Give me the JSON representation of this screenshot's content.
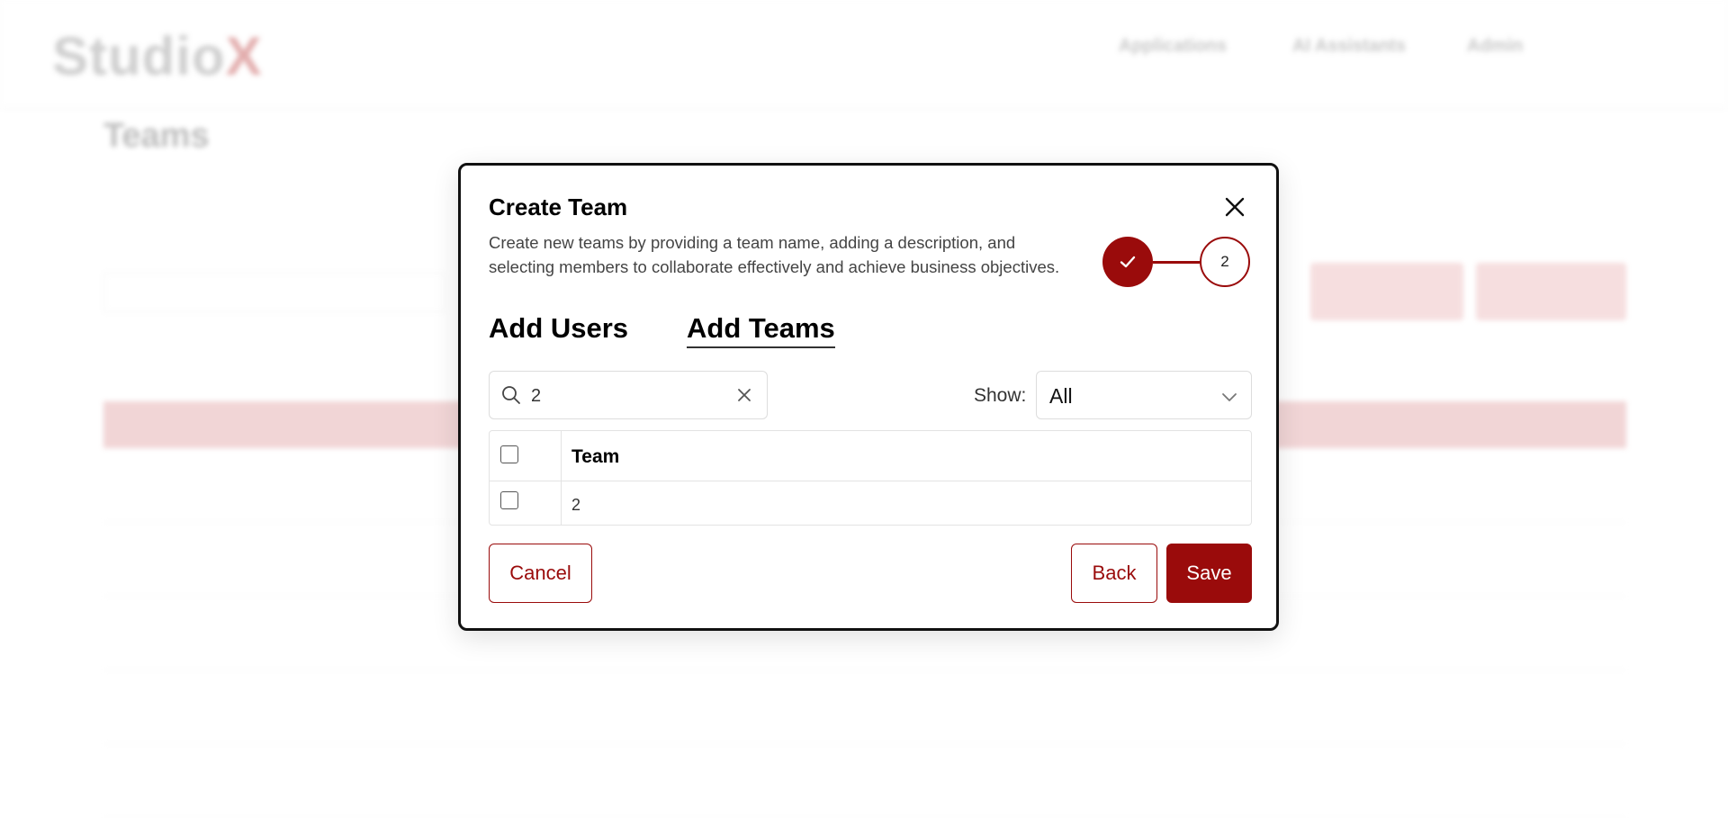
{
  "background": {
    "logo": {
      "main": "Studio",
      "accent": "X"
    },
    "nav": {
      "applications": "Applications",
      "ai_assistants": "AI Assistants",
      "admin": "Admin",
      "admin_sub": ""
    },
    "title": "Teams",
    "subtitle": "",
    "select_label": "",
    "select_value": "",
    "search_label": "",
    "buttons": {
      "import": "",
      "create": ""
    },
    "sort": {
      "sort_by": "",
      "order": ""
    },
    "table_headers": {
      "name": "",
      "created_at": "",
      "actions": ""
    }
  },
  "modal": {
    "title": "Create Team",
    "description": "Create new teams by providing a team name, adding a description, and selecting members to collaborate effectively and achieve business objectives.",
    "stepper": {
      "step2_label": "2",
      "colors": {
        "accent": "#9a0b0b"
      }
    },
    "tabs": {
      "users": "Add Users",
      "teams": "Add Teams"
    },
    "search": {
      "value": "2",
      "placeholder": ""
    },
    "show": {
      "label": "Show:",
      "value": "All"
    },
    "table": {
      "header": "Team",
      "rows": [
        {
          "team": "2"
        }
      ]
    },
    "buttons": {
      "cancel": "Cancel",
      "back": "Back",
      "save": "Save"
    },
    "icons": {
      "close": "close-icon",
      "search": "search-icon",
      "clear": "clear-icon",
      "dropdown": "chevron-down-icon",
      "check": "check-icon"
    }
  }
}
